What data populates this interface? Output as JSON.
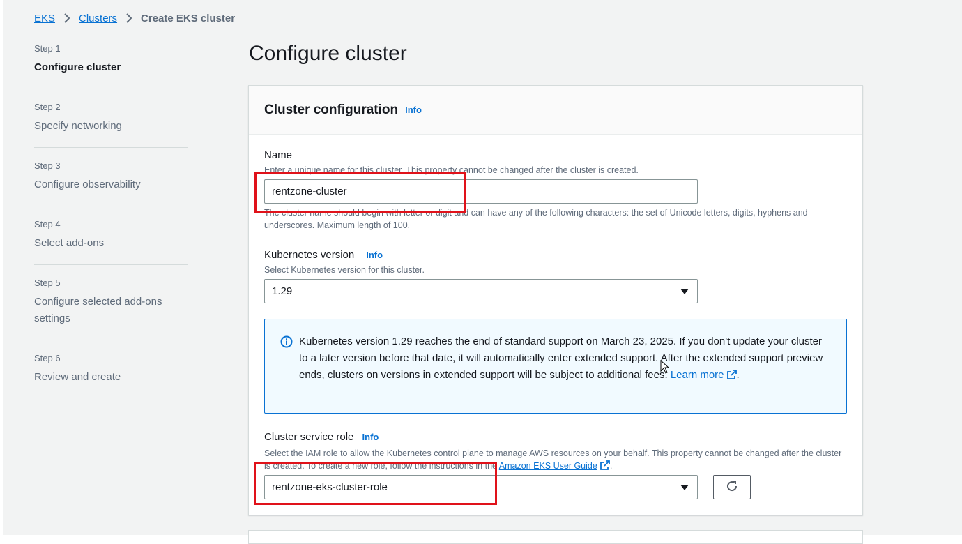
{
  "breadcrumb": {
    "items": [
      {
        "label": "EKS"
      },
      {
        "label": "Clusters"
      }
    ],
    "current": "Create EKS cluster"
  },
  "steps": [
    {
      "number": "Step 1",
      "title": "Configure cluster",
      "active": true
    },
    {
      "number": "Step 2",
      "title": "Specify networking",
      "active": false
    },
    {
      "number": "Step 3",
      "title": "Configure observability",
      "active": false
    },
    {
      "number": "Step 4",
      "title": "Select add-ons",
      "active": false
    },
    {
      "number": "Step 5",
      "title": "Configure selected add-ons settings",
      "active": false
    },
    {
      "number": "Step 6",
      "title": "Review and create",
      "active": false
    }
  ],
  "page_title": "Configure cluster",
  "panel": {
    "title": "Cluster configuration",
    "info": "Info",
    "name": {
      "label": "Name",
      "description": "Enter a unique name for this cluster. This property cannot be changed after the cluster is created.",
      "value": "rentzone-cluster",
      "constraint": "The cluster name should begin with letter or digit and can have any of the following characters: the set of Unicode letters, digits, hyphens and underscores. Maximum length of 100."
    },
    "k8s_version": {
      "label": "Kubernetes version",
      "info": "Info",
      "description": "Select Kubernetes version for this cluster.",
      "value": "1.29"
    },
    "alert": {
      "text": "Kubernetes version 1.29 reaches the end of standard support on March 23, 2025. If you don't update your cluster to a later version before that date, it will automatically enter extended support. After the extended support preview ends, clusters on versions in extended support will be subject to additional fees.",
      "link_label": "Learn more",
      "suffix": "."
    },
    "service_role": {
      "label": "Cluster service role",
      "info": "Info",
      "description": "Select the IAM role to allow the Kubernetes control plane to manage AWS resources on your behalf. This property cannot be changed after the cluster is created. To create a new role, follow the instructions in the",
      "guide_link": "Amazon EKS User Guide",
      "suffix": ".",
      "value": "rentzone-eks-cluster-role"
    }
  },
  "icons": {
    "breadcrumb_separator": "chevron-right-icon",
    "info": "info-circle-icon",
    "external": "external-link-icon",
    "refresh": "refresh-icon",
    "caret": "caret-down-icon"
  },
  "colors": {
    "link": "#0972d3",
    "highlight": "#e0121a",
    "alert_bg": "#f1faff"
  }
}
